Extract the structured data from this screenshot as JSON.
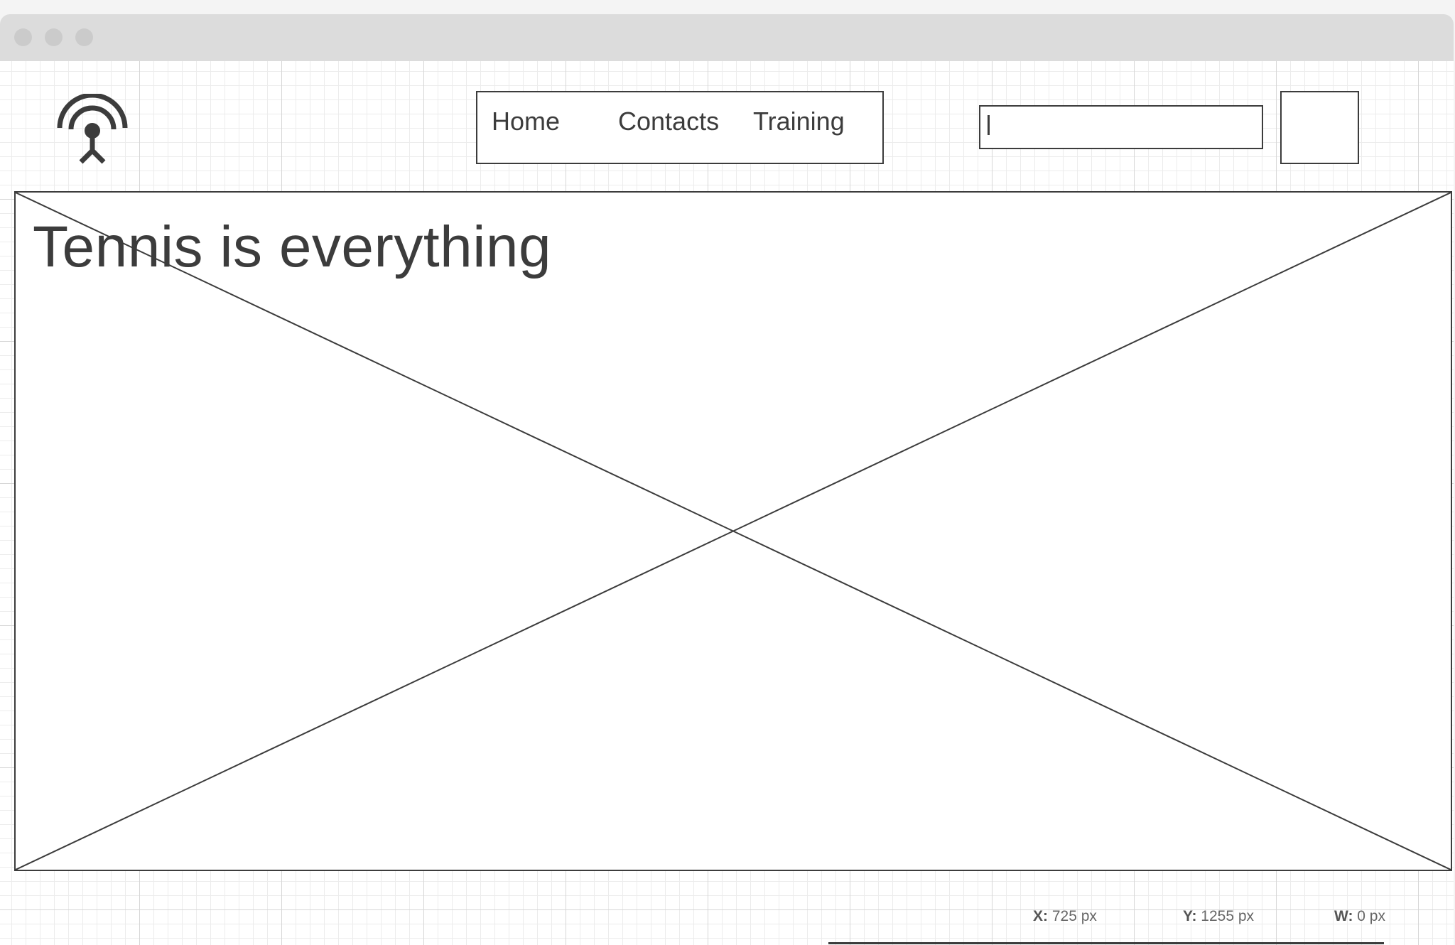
{
  "window": {
    "controls": [
      "close-dot",
      "minimize-dot",
      "maximize-dot"
    ]
  },
  "header": {
    "logo_icon": "broadcast-antenna-icon",
    "nav": [
      {
        "label": "Home"
      },
      {
        "label": "Contacts"
      },
      {
        "label": "Training"
      }
    ],
    "search": {
      "value": "",
      "placeholder": ""
    }
  },
  "hero": {
    "title": "Tennis is everything",
    "image_placeholder": "image-placeholder"
  },
  "statusbar": {
    "x_label": "X:",
    "x_value": "725 px",
    "y_label": "Y:",
    "y_value": "1255 px",
    "w_label": "W:",
    "w_value": "0 px"
  },
  "colors": {
    "stroke": "#3c3c3c",
    "titlebar": "#dcdcdc",
    "grid_major": "#d6d6d6",
    "grid_minor": "#ececec"
  }
}
